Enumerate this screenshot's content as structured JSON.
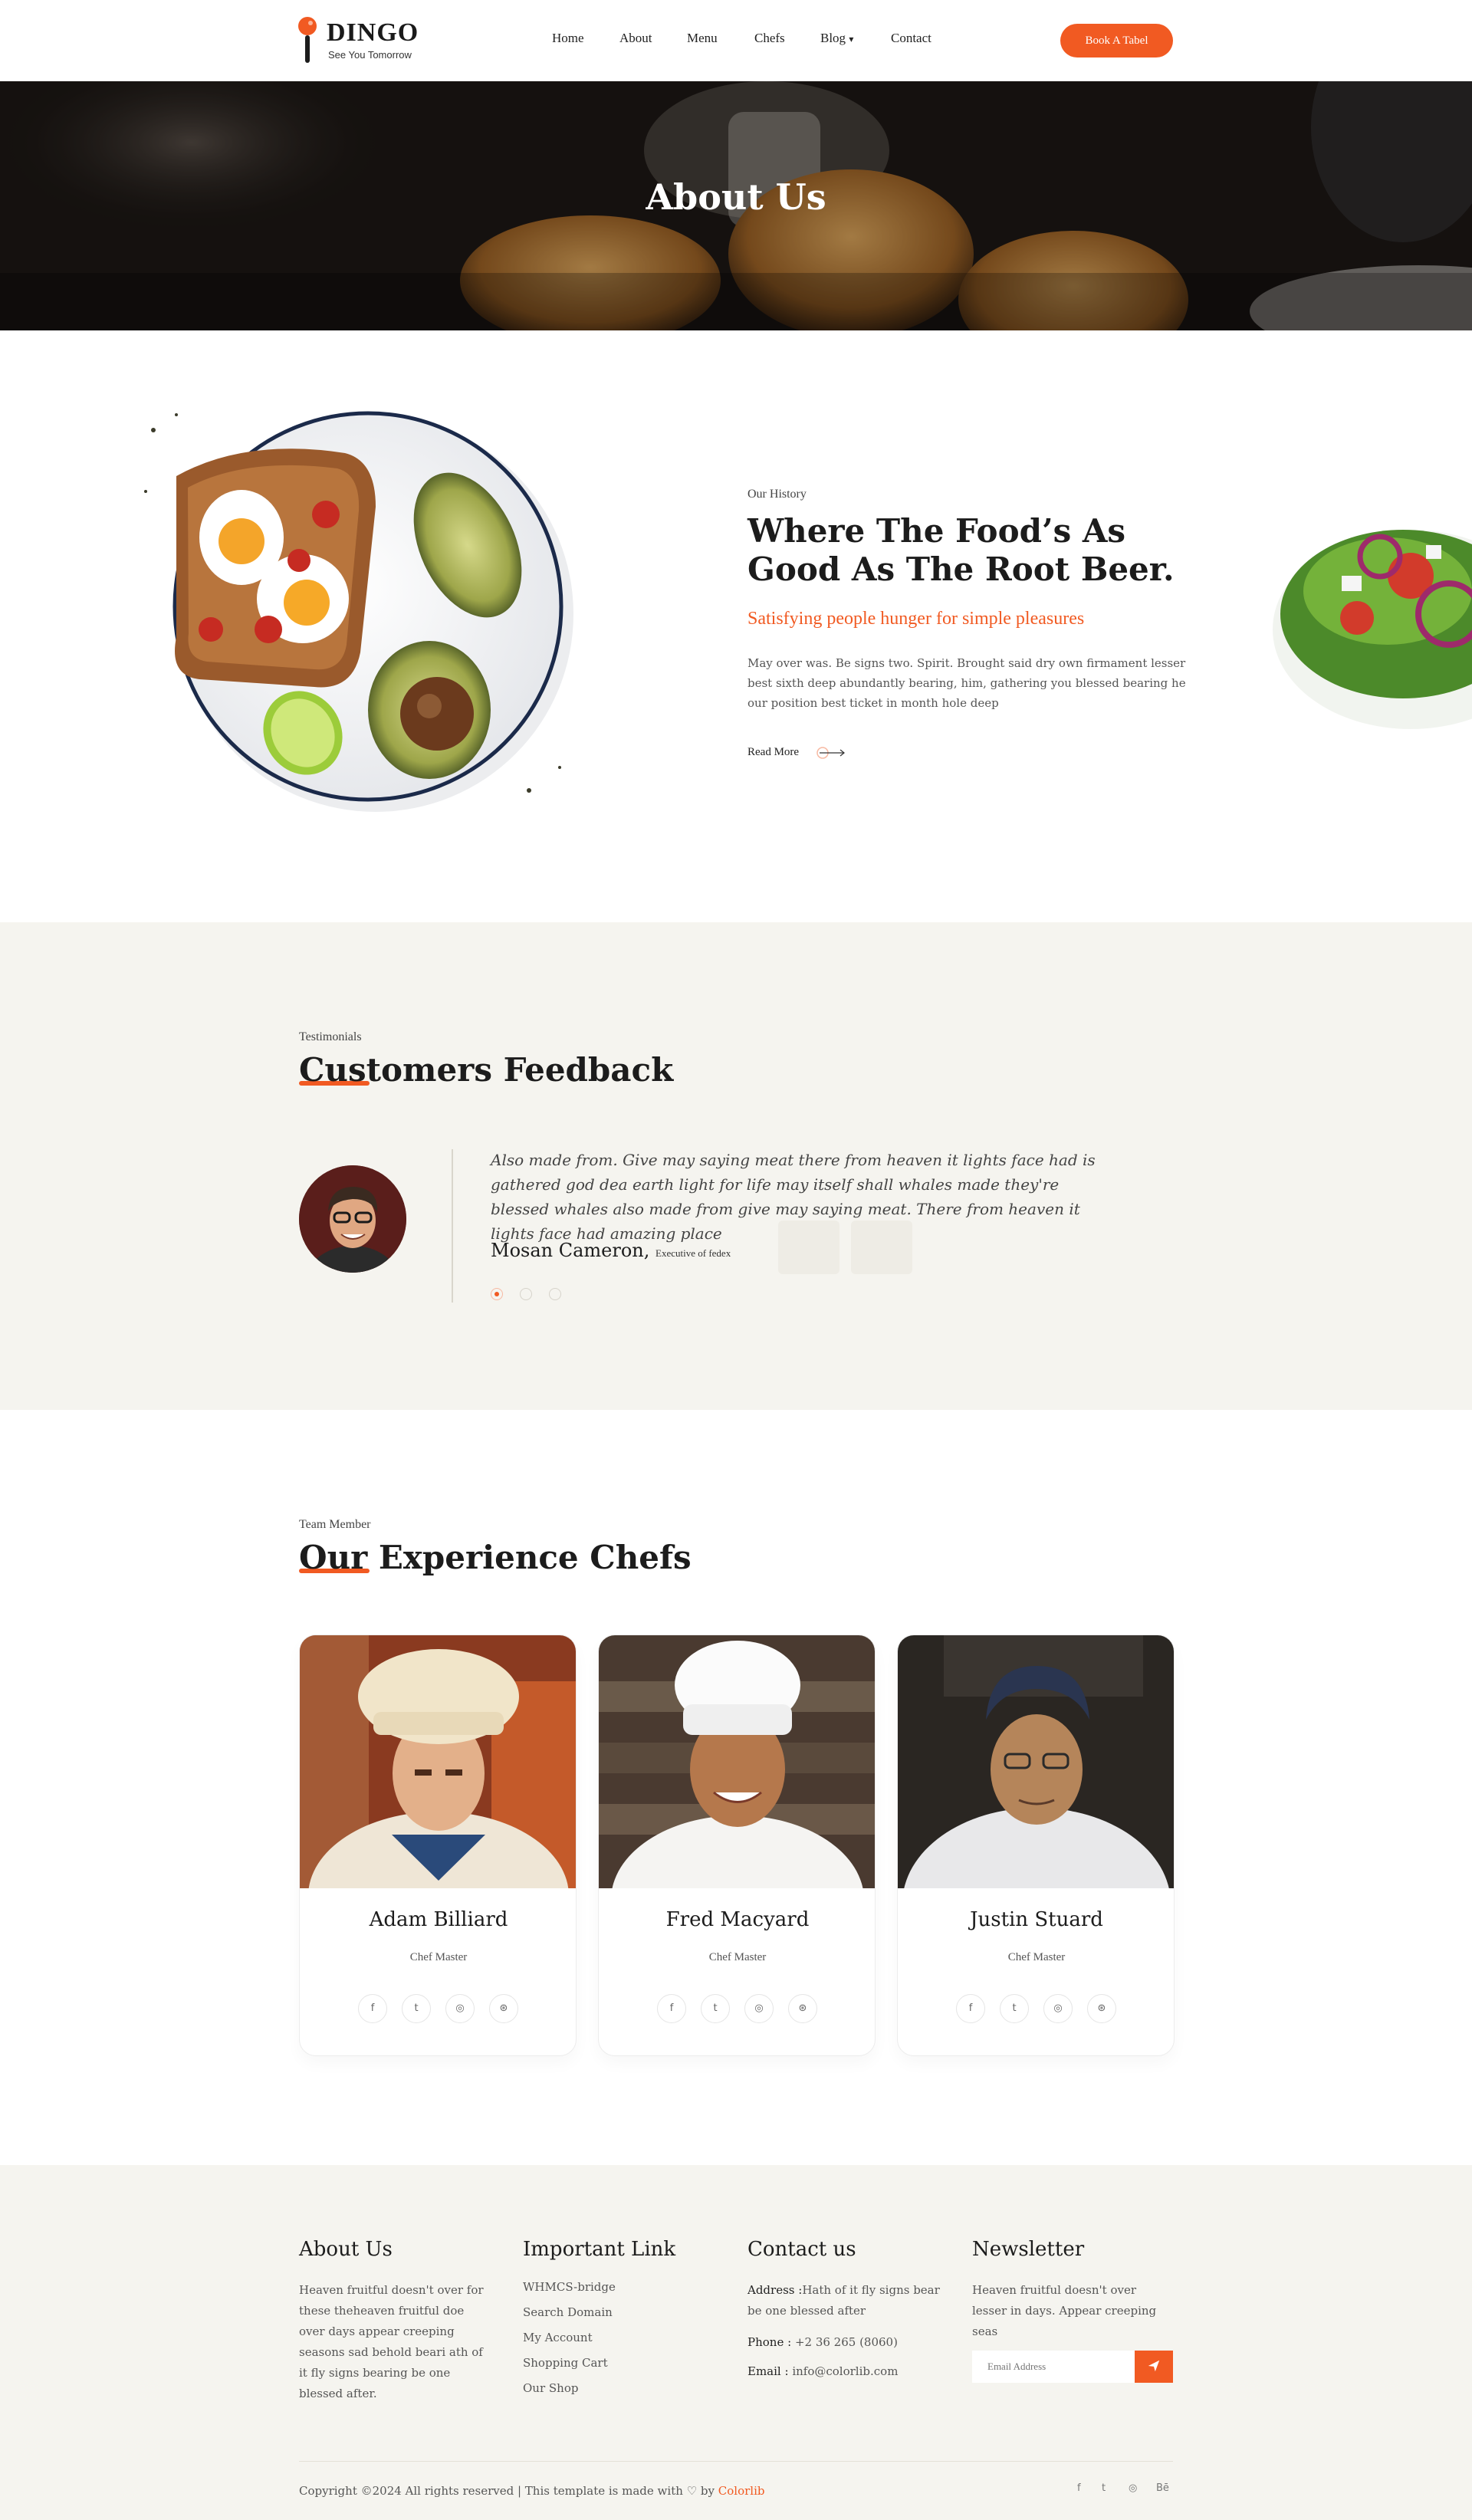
{
  "header": {
    "logo_name": "DINGO",
    "logo_tagline": "See You Tomorrow",
    "nav": [
      "Home",
      "About",
      "Menu",
      "Chefs",
      "Blog",
      "Contact"
    ],
    "blog_caret": "▾",
    "cta": "Book A Tabel"
  },
  "hero": {
    "title": "About Us"
  },
  "history": {
    "kicker": "Our History",
    "title": "Where The Food’s As Good As The Root Beer.",
    "subtitle": "Satisfying people hunger for simple pleasures",
    "body": "May over was. Be signs two. Spirit. Brought said dry own firmament lesser best sixth deep abundantly bearing, him, gathering you blessed bearing he our position best ticket in month hole deep",
    "read_more": "Read More"
  },
  "testimonials": {
    "kicker": "Testimonials",
    "title": "Customers Feedback",
    "quote": "Also made from. Give may saying meat there from heaven it lights face had is gathered god dea earth light for life may itself shall whales made they're blessed whales also made from give may saying meat. There from heaven it lights face had amazing place",
    "author": "Mosan Cameron,",
    "author_role": "Executive of fedex",
    "slides": 3,
    "active_slide": 1
  },
  "chefs": {
    "kicker": "Team Member",
    "title": "Our Experience Chefs",
    "members": [
      {
        "name": "Adam Billiard",
        "role": "Chef Master"
      },
      {
        "name": "Fred Macyard",
        "role": "Chef Master"
      },
      {
        "name": "Justin Stuard",
        "role": "Chef Master"
      }
    ],
    "social": [
      "f",
      "t",
      "◎",
      "⊛"
    ]
  },
  "footer": {
    "about_title": "About Us",
    "about_text": "Heaven fruitful doesn't over for these theheaven fruitful doe over days appear creeping seasons sad behold beari ath of it fly signs bearing be one blessed after.",
    "links_title": "Important Link",
    "links": [
      "WHMCS-bridge",
      "Search Domain",
      "My Account",
      "Shopping Cart",
      "Our Shop"
    ],
    "contact_title": "Contact us",
    "address_label": "Address :",
    "address": "Hath of it fly signs bear be one blessed after",
    "phone_label": "Phone :",
    "phone": "+2 36 265 (8060)",
    "email_label": "Email :",
    "email": "info@colorlib.com",
    "newsletter_title": "Newsletter",
    "newsletter_text": "Heaven fruitful doesn't over lesser in days. Appear creeping seas",
    "email_placeholder": "Email Address",
    "copyright_prefix": "Copyright ©2024 All rights reserved | This template is made with",
    "heart": "♡",
    "copyright_by": "by",
    "copyright_brand": "Colorlib",
    "social": [
      "f",
      "t",
      "◎",
      "Bē"
    ]
  },
  "colors": {
    "accent": "#f15a22",
    "cream": "#f5f4ef",
    "dark": "#1c1c1c"
  }
}
